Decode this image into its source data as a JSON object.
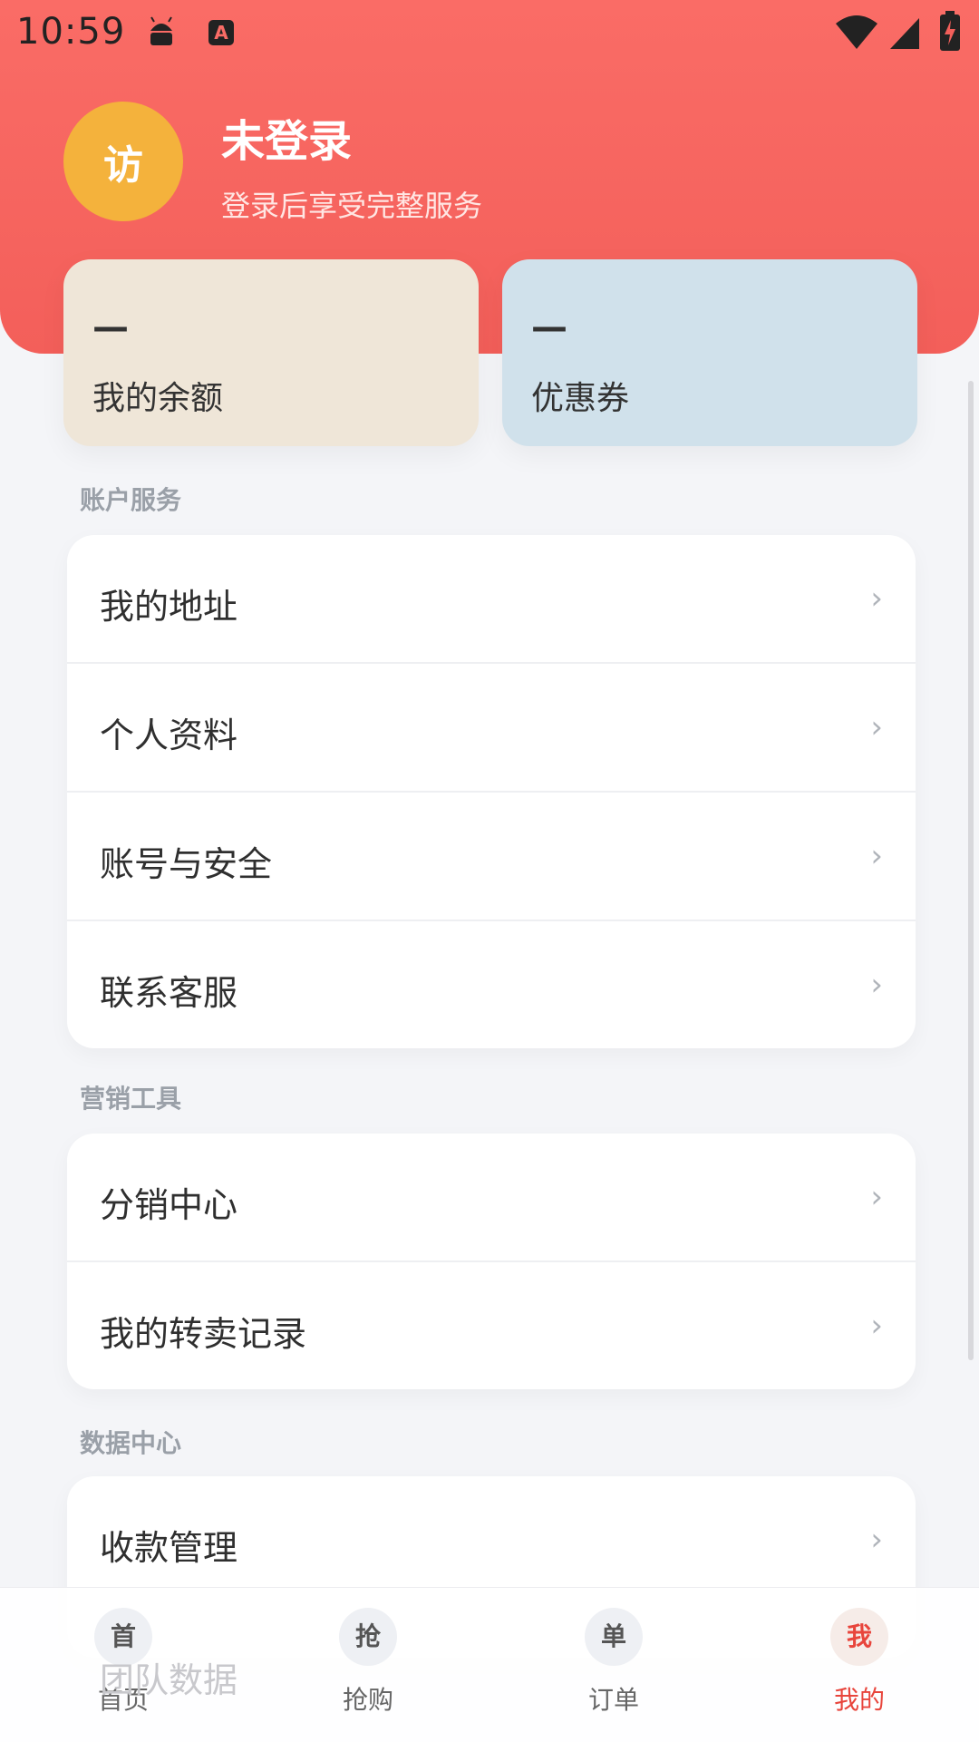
{
  "status_bar": {
    "time": "10:59",
    "a_badge": "A"
  },
  "profile": {
    "avatar_text": "访",
    "name": "未登录",
    "subtitle": "登录后享受完整服务"
  },
  "cards": [
    {
      "value": "—",
      "label": "我的余额"
    },
    {
      "value": "—",
      "label": "优惠券"
    }
  ],
  "sections": [
    {
      "title": "账户服务",
      "items": [
        {
          "label": "我的地址"
        },
        {
          "label": "个人资料"
        },
        {
          "label": "账号与安全"
        },
        {
          "label": "联系客服"
        }
      ]
    },
    {
      "title": "营销工具",
      "items": [
        {
          "label": "分销中心"
        },
        {
          "label": "我的转卖记录"
        }
      ]
    },
    {
      "title": "数据中心",
      "items": [
        {
          "label": "收款管理"
        },
        {
          "label": "团队数据"
        }
      ]
    }
  ],
  "chevron": "›",
  "tabs": [
    {
      "icon_text": "首",
      "label": "首页"
    },
    {
      "icon_text": "抢",
      "label": "抢购"
    },
    {
      "icon_text": "单",
      "label": "订单"
    },
    {
      "icon_text": "我",
      "label": "我的",
      "active": true
    }
  ],
  "colors": {
    "header": "#f35f5a",
    "avatar": "#f4b23c",
    "active_tab": "#e8453c",
    "balance_card": "#efe6d8",
    "coupon_card": "#d0e1eb"
  }
}
